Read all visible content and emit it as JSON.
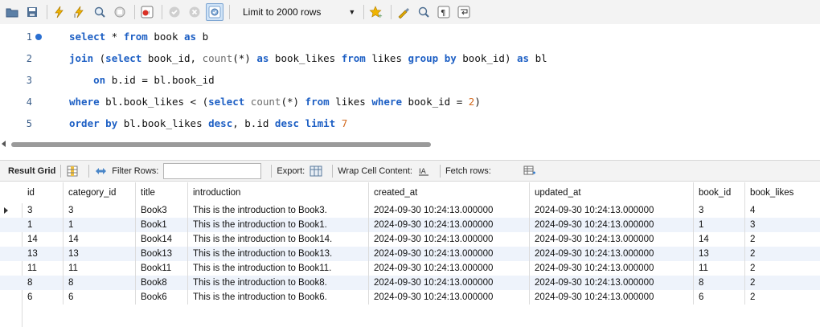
{
  "toolbar": {
    "limit_label": "Limit to 2000 rows",
    "icons": [
      "open-folder-icon",
      "save-icon",
      "execute-icon",
      "execute-current-icon",
      "explain-icon",
      "stop-icon",
      "toggle-error-icon",
      "commit-icon",
      "rollback-icon",
      "autocommit-icon",
      "bookmark-icon",
      "beautify-icon",
      "find-icon",
      "invisible-chars-icon",
      "wrap-icon"
    ]
  },
  "editor": {
    "lines": [
      {
        "num": "1"
      },
      {
        "num": "2"
      },
      {
        "num": "3"
      },
      {
        "num": "4"
      },
      {
        "num": "5"
      }
    ],
    "tokens": {
      "l1_select": "select",
      "l1_star": " * ",
      "l1_from": "from",
      "l1_book": " book ",
      "l1_as": "as",
      "l1_b": " b",
      "l2_join": "join",
      "l2_open": " (",
      "l2_select": "select",
      "l2_bookid": " book_id, ",
      "l2_count": "count",
      "l2_star": "(*) ",
      "l2_as": "as",
      "l2_bl_likes": " book_likes ",
      "l2_from": "from",
      "l2_likes": " likes ",
      "l2_group": "group",
      "l2_by": "by",
      "l2_bookid2": " book_id) ",
      "l2_as2": "as",
      "l2_bl": " bl",
      "l3_on": "on",
      "l3_rest": " b.id = bl.book_id",
      "l4_where": "where",
      "l4_mid": " bl.book_likes < (",
      "l4_select": "select",
      "l4_count": "count",
      "l4_star": "(*) ",
      "l4_from": "from",
      "l4_likes": " likes ",
      "l4_where2": "where",
      "l4_bookid": " book_id = ",
      "l4_num": "2",
      "l4_close": ")",
      "l5_order": "order",
      "l5_by": "by",
      "l5_mid": " bl.book_likes ",
      "l5_desc": "desc",
      "l5_comma": ", b.id ",
      "l5_desc2": "desc",
      "l5_limit": "limit",
      "l5_num": "7"
    }
  },
  "result_bar": {
    "title": "Result Grid",
    "filter_label": "Filter Rows:",
    "filter_value": "",
    "export_label": "Export:",
    "wrap_label": "Wrap Cell Content:",
    "fetch_label": "Fetch rows:"
  },
  "grid": {
    "columns": [
      "id",
      "category_id",
      "title",
      "introduction",
      "created_at",
      "updated_at",
      "book_id",
      "book_likes"
    ],
    "rows": [
      [
        "3",
        "3",
        "Book3",
        "This is the introduction to Book3.",
        "2024-09-30 10:24:13.000000",
        "2024-09-30 10:24:13.000000",
        "3",
        "4"
      ],
      [
        "1",
        "1",
        "Book1",
        "This is the introduction to Book1.",
        "2024-09-30 10:24:13.000000",
        "2024-09-30 10:24:13.000000",
        "1",
        "3"
      ],
      [
        "14",
        "14",
        "Book14",
        "This is the introduction to Book14.",
        "2024-09-30 10:24:13.000000",
        "2024-09-30 10:24:13.000000",
        "14",
        "2"
      ],
      [
        "13",
        "13",
        "Book13",
        "This is the introduction to Book13.",
        "2024-09-30 10:24:13.000000",
        "2024-09-30 10:24:13.000000",
        "13",
        "2"
      ],
      [
        "11",
        "11",
        "Book11",
        "This is the introduction to Book11.",
        "2024-09-30 10:24:13.000000",
        "2024-09-30 10:24:13.000000",
        "11",
        "2"
      ],
      [
        "8",
        "8",
        "Book8",
        "This is the introduction to Book8.",
        "2024-09-30 10:24:13.000000",
        "2024-09-30 10:24:13.000000",
        "8",
        "2"
      ],
      [
        "6",
        "6",
        "Book6",
        "This is the introduction to Book6.",
        "2024-09-30 10:24:13.000000",
        "2024-09-30 10:24:13.000000",
        "6",
        "2"
      ]
    ]
  },
  "colors": {
    "keyword": "#1d5fc4",
    "function": "#6c6c6c",
    "number": "#d2691e",
    "alt_row": "#eef3fb"
  }
}
